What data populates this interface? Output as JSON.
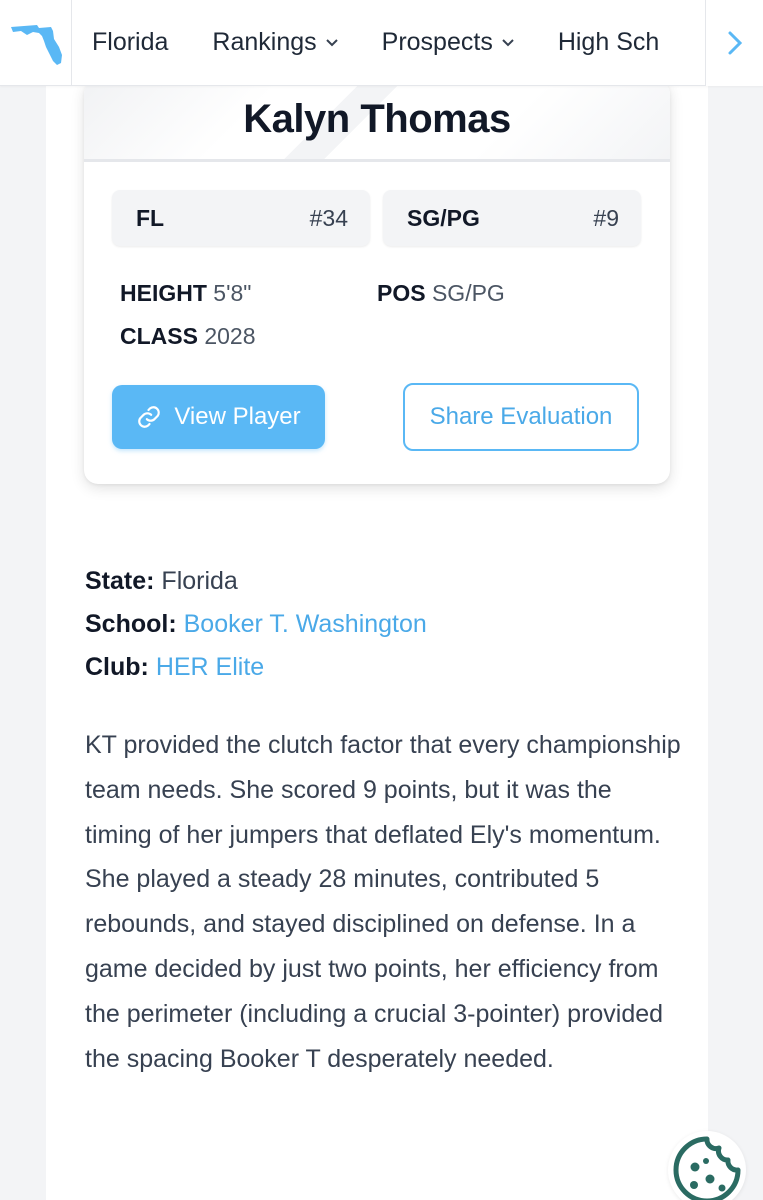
{
  "nav": {
    "state_label": "Florida",
    "items": [
      {
        "label": "Rankings",
        "has_dropdown": true
      },
      {
        "label": "Prospects",
        "has_dropdown": true
      },
      {
        "label": "High Sch",
        "has_dropdown": false
      }
    ],
    "scroll_icon": "chevron-right-icon"
  },
  "card": {
    "player_name": "Kalyn Thomas",
    "state_rank": {
      "label": "FL",
      "rank": "#34"
    },
    "position_rank": {
      "label": "SG/PG",
      "rank": "#9"
    },
    "attributes": {
      "height_label": "HEIGHT",
      "height_value": "5'8\"",
      "pos_label": "POS",
      "pos_value": "SG/PG",
      "class_label": "CLASS",
      "class_value": "2028"
    },
    "view_button": "View Player",
    "share_button": "Share Evaluation"
  },
  "details": {
    "state_label": "State:",
    "state_value": "Florida",
    "school_label": "School:",
    "school_value": "Booker T. Washington",
    "club_label": "Club:",
    "club_value": "HER Elite"
  },
  "summary": "KT provided the clutch factor that every championship team needs. She scored 9 points, but it was the timing of her jumpers that deflated Ely's momentum. She played a steady 28 minutes, contributed 5 rebounds, and stayed disciplined on defense. In a game decided by just two points, her efficiency from the perimeter (including a crucial 3-pointer) provided the spacing Booker T desperately needed.",
  "colors": {
    "accent": "#5ab8f5",
    "link": "#4aa9e8",
    "cookie": "#2a6b62"
  }
}
